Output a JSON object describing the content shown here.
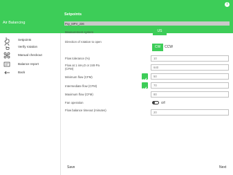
{
  "header": {
    "app_title": "Air Balancing",
    "panel_title": "Setpoints",
    "info_icon": "info-icon",
    "brand_color": "#3dcd58"
  },
  "sidebar": {
    "items": [
      {
        "label": "Setpoints",
        "icon": "hand-point-icon"
      },
      {
        "label": "Verify rotation",
        "icon": "hand-rotate-icon"
      },
      {
        "label": "Manual checkout",
        "icon": "wrench-screwdriver-icon"
      },
      {
        "label": "Balance report",
        "icon": "report-icon"
      },
      {
        "label": "Back",
        "icon": "back-arrow-icon"
      }
    ]
  },
  "device": {
    "name": "Pxy_MPV_236"
  },
  "form": {
    "measurement_system": {
      "label": "Measurement system",
      "selected": "US"
    },
    "rotation": {
      "label": "Direction of rotation to open",
      "options": [
        "CW",
        "CCW"
      ],
      "selected": "CW"
    },
    "flow_tolerance": {
      "label": "Flow tolerance (%)",
      "value": "10"
    },
    "flow_1inh2o": {
      "label": "Flow at 1 inH₂O or 249 Pa (CFM)",
      "value": "640"
    },
    "min_flow": {
      "label": "Minimum flow (CFM)",
      "value": "50",
      "checked": true
    },
    "intermediate_flow": {
      "label": "Intermediate flow (CFM)",
      "value": "70",
      "checked": true
    },
    "max_flow": {
      "label": "Maximum flow (CFM)",
      "value": "80"
    },
    "fan_operation": {
      "label": "Fan operation",
      "state": "Off"
    },
    "flow_balance_timeout": {
      "label": "Flow balance timeout (minutes)",
      "value": "20"
    }
  },
  "footer": {
    "save_label": "Save",
    "next_label": "Next"
  }
}
